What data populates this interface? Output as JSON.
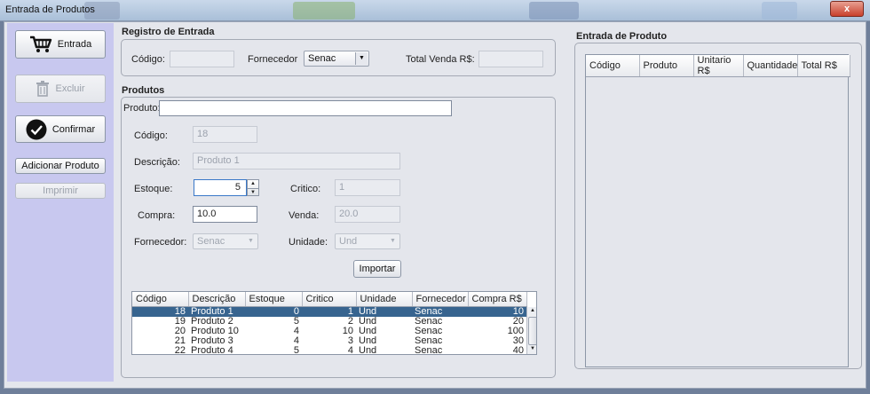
{
  "window": {
    "title": "Entrada de Produtos",
    "close_label": "x"
  },
  "sidebar": {
    "entrada_label": "Entrada",
    "excluir_label": "Excluir",
    "confirmar_label": "Confirmar",
    "adicionar_label": "Adicionar Produto",
    "imprimir_label": "Imprimir"
  },
  "registro": {
    "title": "Registro de Entrada",
    "codigo_label": "Código:",
    "codigo_value": "",
    "fornecedor_label": "Fornecedor",
    "fornecedor_value": "Senac",
    "total_label": "Total Venda R$:",
    "total_value": ""
  },
  "produtos": {
    "title": "Produtos",
    "produto_label": "Produto:",
    "produto_value": "",
    "codigo_label": "Código:",
    "codigo_value": "18",
    "descricao_label": "Descrição:",
    "descricao_value": "Produto 1",
    "estoque_label": "Estoque:",
    "estoque_value": "5",
    "critico_label": "Critico:",
    "critico_value": "1",
    "compra_label": "Compra:",
    "compra_value": "10.0",
    "venda_label": "Venda:",
    "venda_value": "20.0",
    "fornecedor_label": "Fornecedor:",
    "fornecedor_value": "Senac",
    "unidade_label": "Unidade:",
    "unidade_value": "Und",
    "importar_label": "Importar"
  },
  "produtos_table": {
    "columns": [
      "Código",
      "Descrição",
      "Estoque",
      "Critico",
      "Unidade",
      "Fornecedor",
      "Compra R$"
    ],
    "rows": [
      [
        "18",
        "Produto 1",
        "0",
        "1",
        "Und",
        "Senac",
        "10"
      ],
      [
        "19",
        "Produto 2",
        "5",
        "2",
        "Und",
        "Senac",
        "20"
      ],
      [
        "20",
        "Produto 10",
        "4",
        "10",
        "Und",
        "Senac",
        "100"
      ],
      [
        "21",
        "Produto 3",
        "4",
        "3",
        "Und",
        "Senac",
        "30"
      ],
      [
        "22",
        "Produto 4",
        "5",
        "4",
        "Und",
        "Senac",
        "40"
      ]
    ],
    "selected_row": 0
  },
  "entrada": {
    "title": "Entrada de Produto",
    "columns": [
      "Código",
      "Produto",
      "Unitario R$",
      "Quantidade",
      "Total R$"
    ]
  },
  "colors": {
    "sidebar": "#c8c8ef",
    "selection": "#37648f",
    "panel": "#e4e6ec"
  }
}
